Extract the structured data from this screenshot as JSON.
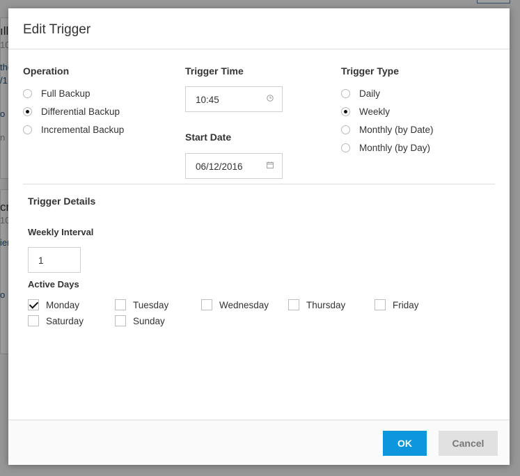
{
  "background": {
    "fragments": [
      "ıll",
      "10",
      "the",
      "/1",
      "o",
      "n",
      "cr",
      "10",
      "ier",
      "o"
    ]
  },
  "dialog": {
    "title": "Edit Trigger",
    "operation": {
      "label": "Operation",
      "options": [
        "Full Backup",
        "Differential Backup",
        "Incremental Backup"
      ],
      "selected": "Differential Backup"
    },
    "trigger_time": {
      "label": "Trigger Time",
      "value": "10:45",
      "icon": "clock-icon"
    },
    "start_date": {
      "label": "Start Date",
      "value": "06/12/2016",
      "icon": "calendar-icon"
    },
    "trigger_type": {
      "label": "Trigger Type",
      "options": [
        "Daily",
        "Weekly",
        "Monthly (by Date)",
        "Monthly (by Day)"
      ],
      "selected": "Weekly"
    },
    "details": {
      "label": "Trigger Details",
      "weekly_interval_label": "Weekly Interval",
      "weekly_interval_value": "1",
      "active_days_label": "Active Days",
      "days": [
        {
          "label": "Monday",
          "checked": true
        },
        {
          "label": "Tuesday",
          "checked": false
        },
        {
          "label": "Wednesday",
          "checked": false
        },
        {
          "label": "Thursday",
          "checked": false
        },
        {
          "label": "Friday",
          "checked": false
        },
        {
          "label": "Saturday",
          "checked": false
        },
        {
          "label": "Sunday",
          "checked": false
        }
      ]
    },
    "buttons": {
      "ok": "OK",
      "cancel": "Cancel"
    },
    "colors": {
      "primary": "#0d96dc",
      "secondary": "#e1e1e1"
    }
  }
}
